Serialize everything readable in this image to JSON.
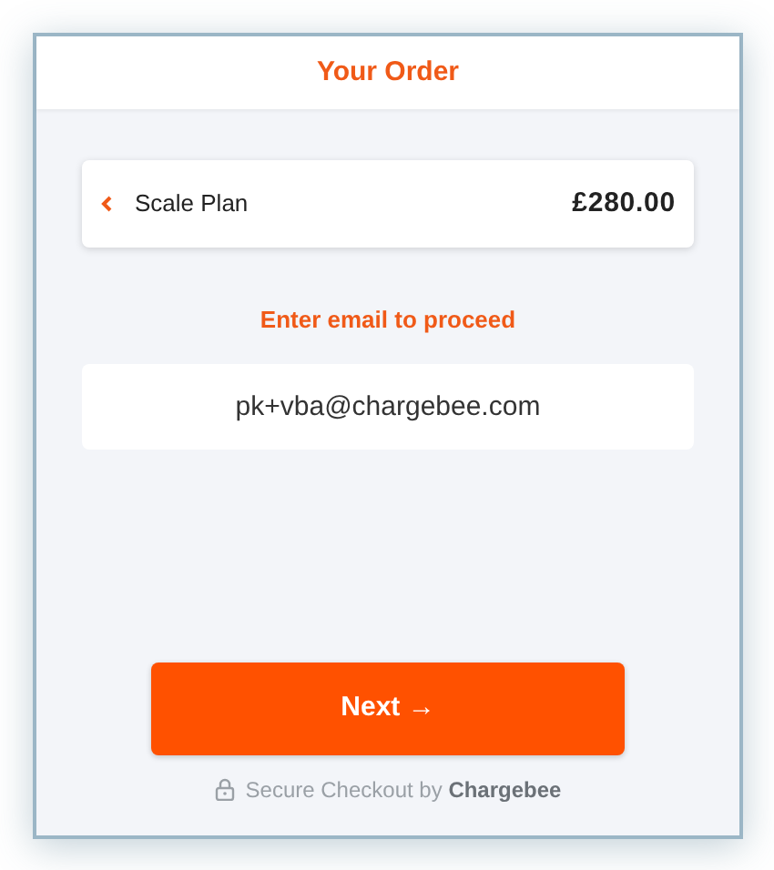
{
  "header": {
    "title": "Your Order"
  },
  "plan": {
    "name": "Scale Plan",
    "price": "£280.00"
  },
  "prompt": "Enter email to proceed",
  "email": {
    "value": "pk+vba@chargebee.com"
  },
  "next_button": {
    "label": "Next →"
  },
  "footer": "Secure Checkout by **Chargebee**"
}
